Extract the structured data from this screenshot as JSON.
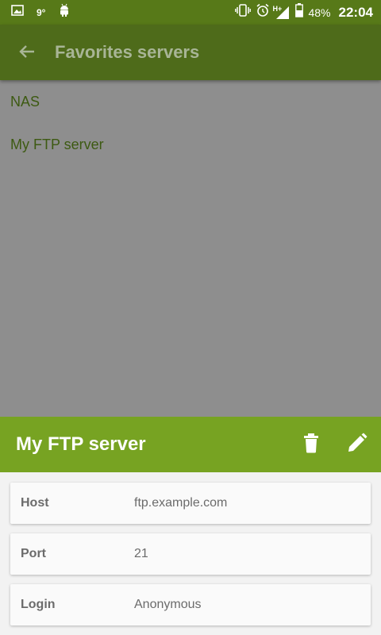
{
  "status_bar": {
    "temperature": "9°",
    "network": "H+",
    "battery": "48%",
    "time": "22:04",
    "icons": [
      "gallery-icon",
      "android-icon",
      "vibrate-icon",
      "alarm-icon",
      "signal-icon",
      "battery-icon"
    ]
  },
  "toolbar": {
    "back_icon": "arrow-left-icon",
    "title": "Favorites servers"
  },
  "favorites": [
    {
      "label": "NAS"
    },
    {
      "label": "My FTP server"
    }
  ],
  "sheet": {
    "title": "My FTP server",
    "actions": [
      "trash-icon",
      "pencil-icon"
    ],
    "details": [
      {
        "label": "Host",
        "value": "ftp.example.com"
      },
      {
        "label": "Port",
        "value": "21"
      },
      {
        "label": "Login",
        "value": "Anonymous"
      }
    ]
  },
  "colors": {
    "status_bar": "#577918",
    "toolbar_dimmed": "#4e6b1a",
    "scrim": "#8e8e8e",
    "sheet_header": "#77a322",
    "list_text": "#3d5a12"
  }
}
